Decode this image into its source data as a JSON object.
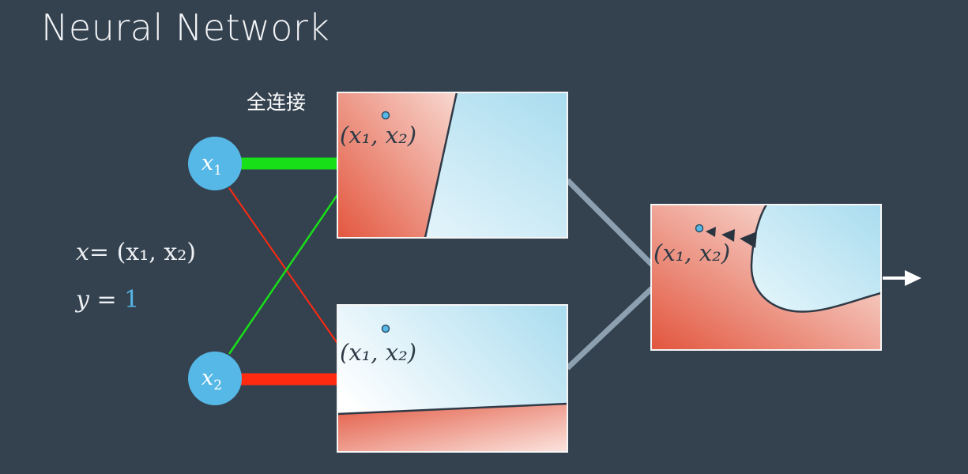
{
  "title": "Neural Network",
  "layer_label": "全连接",
  "equations": {
    "x_lhs": "x",
    "x_rhs": "= (x₁, x₂)",
    "y_lhs": "y",
    "y_eq": " = ",
    "y_value": "1"
  },
  "inputs": [
    {
      "var": "x",
      "sub": "1"
    },
    {
      "var": "x",
      "sub": "2"
    }
  ],
  "panels": [
    {
      "point_label": "(x₁, x₂)"
    },
    {
      "point_label": "(x₁, x₂)"
    },
    {
      "point_label": "(x₁, x₂)"
    }
  ],
  "colors": {
    "background": "#34414f",
    "positive_weight": "#18e018",
    "negative_weight": "#ff2a10",
    "node": "#56b8e6",
    "red_region": "#e8604a",
    "blue_region": "#bfe6f2",
    "connector": "#8da0b0"
  }
}
